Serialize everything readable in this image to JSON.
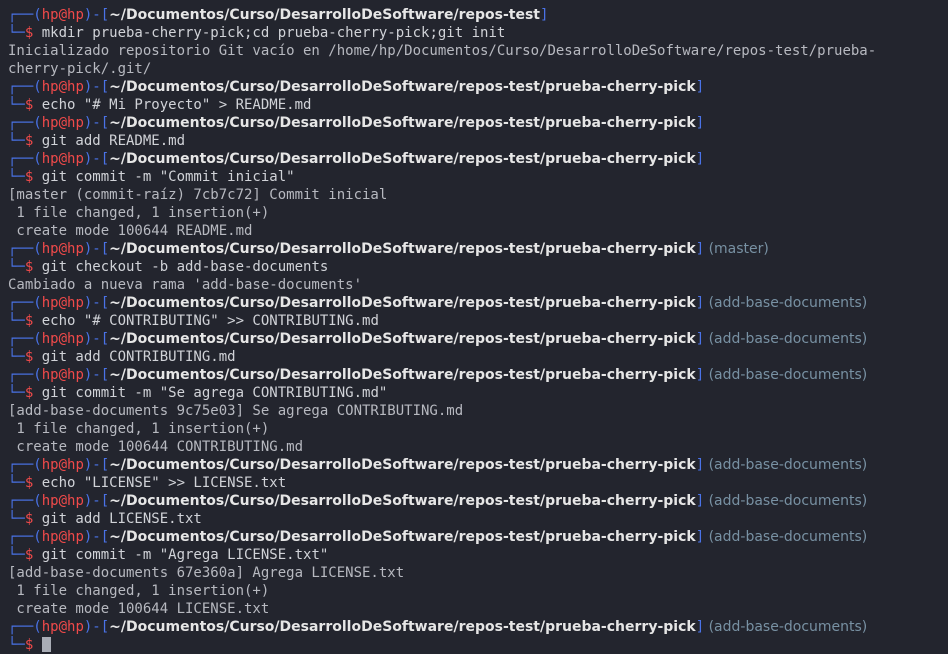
{
  "terminal": {
    "user": "hp",
    "host": "hp",
    "blocks": [
      {
        "path": "~/Documentos/Curso/DesarrolloDeSoftware/repos-test",
        "branch": "",
        "command": "mkdir prueba-cherry-pick;cd prueba-cherry-pick;git init",
        "output": [
          "Inicializado repositorio Git vacío en /home/hp/Documentos/Curso/DesarrolloDeSoftware/repos-test/prueba-",
          "cherry-pick/.git/"
        ]
      },
      {
        "path": "~/Documentos/Curso/DesarrolloDeSoftware/repos-test/prueba-cherry-pick",
        "branch": "",
        "command": "echo \"# Mi Proyecto\" > README.md",
        "output": []
      },
      {
        "path": "~/Documentos/Curso/DesarrolloDeSoftware/repos-test/prueba-cherry-pick",
        "branch": "",
        "command": "git add README.md",
        "output": []
      },
      {
        "path": "~/Documentos/Curso/DesarrolloDeSoftware/repos-test/prueba-cherry-pick",
        "branch": "",
        "command": "git commit -m \"Commit inicial\"",
        "output": [
          "[master (commit-raíz) 7cb7c72] Commit inicial",
          " 1 file changed, 1 insertion(+)",
          " create mode 100644 README.md"
        ]
      },
      {
        "path": "~/Documentos/Curso/DesarrolloDeSoftware/repos-test/prueba-cherry-pick",
        "branch": "(master)",
        "command": "git checkout -b add-base-documents",
        "output": [
          "Cambiado a nueva rama 'add-base-documents'"
        ]
      },
      {
        "path": "~/Documentos/Curso/DesarrolloDeSoftware/repos-test/prueba-cherry-pick",
        "branch": "(add-base-documents)",
        "command": "echo \"# CONTRIBUTING\" >> CONTRIBUTING.md",
        "output": []
      },
      {
        "path": "~/Documentos/Curso/DesarrolloDeSoftware/repos-test/prueba-cherry-pick",
        "branch": "(add-base-documents)",
        "command": "git add CONTRIBUTING.md",
        "output": []
      },
      {
        "path": "~/Documentos/Curso/DesarrolloDeSoftware/repos-test/prueba-cherry-pick",
        "branch": "(add-base-documents)",
        "command": "git commit -m \"Se agrega CONTRIBUTING.md\"",
        "output": [
          "[add-base-documents 9c75e03] Se agrega CONTRIBUTING.md",
          " 1 file changed, 1 insertion(+)",
          " create mode 100644 CONTRIBUTING.md"
        ]
      },
      {
        "path": "~/Documentos/Curso/DesarrolloDeSoftware/repos-test/prueba-cherry-pick",
        "branch": "(add-base-documents)",
        "command": "echo \"LICENSE\" >> LICENSE.txt",
        "output": []
      },
      {
        "path": "~/Documentos/Curso/DesarrolloDeSoftware/repos-test/prueba-cherry-pick",
        "branch": "(add-base-documents)",
        "command": "git add LICENSE.txt",
        "output": []
      },
      {
        "path": "~/Documentos/Curso/DesarrolloDeSoftware/repos-test/prueba-cherry-pick",
        "branch": "(add-base-documents)",
        "command": "git commit -m \"Agrega LICENSE.txt\"",
        "output": [
          "[add-base-documents 67e360a] Agrega LICENSE.txt",
          " 1 file changed, 1 insertion(+)",
          " create mode 100644 LICENSE.txt"
        ]
      },
      {
        "path": "~/Documentos/Curso/DesarrolloDeSoftware/repos-test/prueba-cherry-pick",
        "branch": "(add-base-documents)",
        "command": "",
        "output": [],
        "current": true
      }
    ]
  },
  "colors": {
    "background": "#23252e",
    "box": "#4a73e8",
    "user": "#f04a4a",
    "path": "#e6e6e6",
    "branch": "#7891a3",
    "text": "#b7b9c0"
  }
}
